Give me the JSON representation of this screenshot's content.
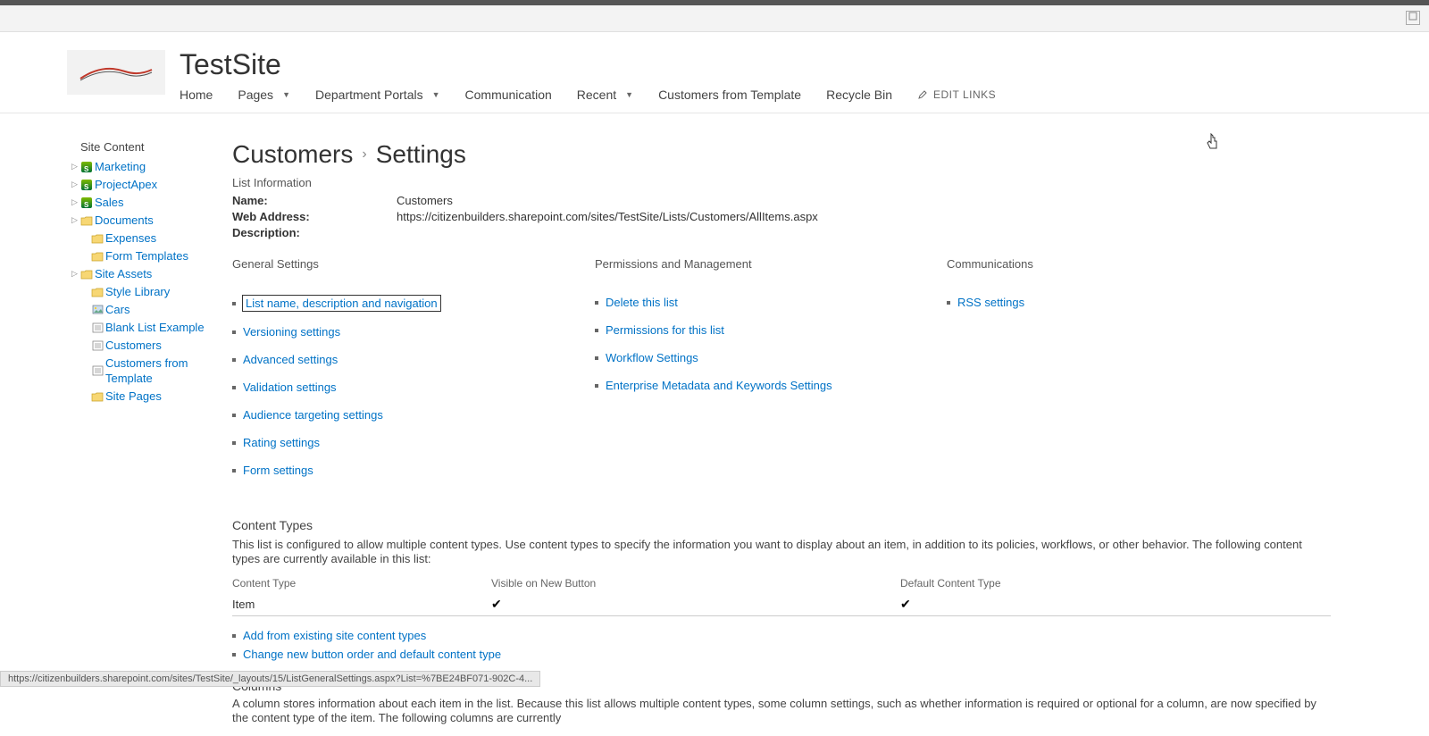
{
  "site_title": "TestSite",
  "top_nav": {
    "items": [
      {
        "label": "Home",
        "has_dropdown": false
      },
      {
        "label": "Pages",
        "has_dropdown": true
      },
      {
        "label": "Department Portals",
        "has_dropdown": true
      },
      {
        "label": "Communication",
        "has_dropdown": false
      },
      {
        "label": "Recent",
        "has_dropdown": true
      },
      {
        "label": "Customers from Template",
        "has_dropdown": false
      },
      {
        "label": "Recycle Bin",
        "has_dropdown": false
      }
    ],
    "edit_links_label": "EDIT LINKS"
  },
  "quick_launch": {
    "header": "Site Content",
    "items": [
      {
        "label": "Marketing",
        "icon": "sp",
        "tree": true
      },
      {
        "label": "ProjectApex",
        "icon": "sp",
        "tree": true
      },
      {
        "label": "Sales",
        "icon": "sp",
        "tree": true
      },
      {
        "label": "Documents",
        "icon": "folder",
        "tree": true
      },
      {
        "label": "Expenses",
        "icon": "folder",
        "indent": true
      },
      {
        "label": "Form Templates",
        "icon": "folder",
        "indent": true
      },
      {
        "label": "Site Assets",
        "icon": "folder",
        "tree": true
      },
      {
        "label": "Style Library",
        "icon": "folder",
        "indent": true
      },
      {
        "label": "Cars",
        "icon": "pic",
        "indent": true
      },
      {
        "label": "Blank List Example",
        "icon": "list",
        "indent": true
      },
      {
        "label": "Customers",
        "icon": "list",
        "indent": true
      },
      {
        "label": "Customers from Template",
        "icon": "list",
        "indent": true
      },
      {
        "label": "Site Pages",
        "icon": "folder",
        "indent": true
      }
    ]
  },
  "breadcrumb": {
    "parent": "Customers",
    "current": "Settings"
  },
  "list_info": {
    "section_label": "List Information",
    "name_label": "Name:",
    "name_value": "Customers",
    "web_label": "Web Address:",
    "web_value": "https://citizenbuilders.sharepoint.com/sites/TestSite/Lists/Customers/AllItems.aspx",
    "desc_label": "Description:",
    "desc_value": ""
  },
  "settings_columns": {
    "general": {
      "header": "General Settings",
      "links": [
        "List name, description and navigation",
        "Versioning settings",
        "Advanced settings",
        "Validation settings",
        "Audience targeting settings",
        "Rating settings",
        "Form settings"
      ]
    },
    "permissions": {
      "header": "Permissions and Management",
      "links": [
        "Delete this list",
        "Permissions for this list",
        "Workflow Settings",
        "Enterprise Metadata and Keywords Settings"
      ]
    },
    "communications": {
      "header": "Communications",
      "links": [
        "RSS settings"
      ]
    }
  },
  "content_types": {
    "header": "Content Types",
    "description": "This list is configured to allow multiple content types. Use content types to specify the information you want to display about an item, in addition to its policies, workflows, or other behavior. The following content types are currently available in this list:",
    "table_headers": {
      "c1": "Content Type",
      "c2": "Visible on New Button",
      "c3": "Default Content Type"
    },
    "rows": [
      {
        "name": "Item",
        "visible": "✔",
        "default": "✔"
      }
    ],
    "action_links": [
      "Add from existing site content types",
      "Change new button order and default content type"
    ]
  },
  "columns_section": {
    "header": "Columns",
    "description": "A column stores information about each item in the list. Because this list allows multiple content types, some column settings, such as whether information is required or optional for a column, are now specified by the content type of the item. The following columns are currently"
  },
  "status_bar_url": "https://citizenbuilders.sharepoint.com/sites/TestSite/_layouts/15/ListGeneralSettings.aspx?List=%7BE24BF071-902C-4..."
}
